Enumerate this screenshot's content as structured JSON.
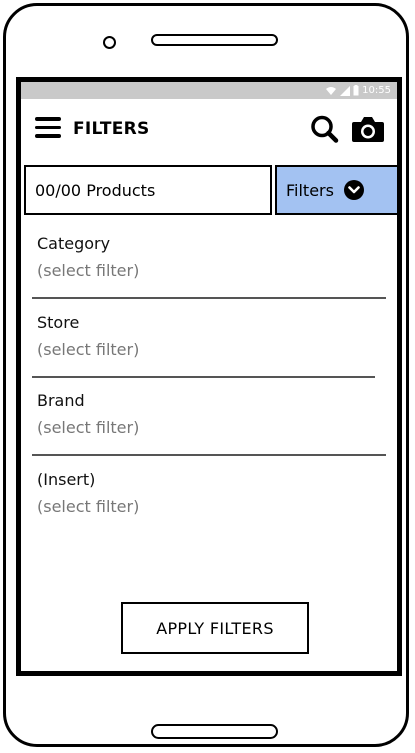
{
  "statusbar": {
    "time": "10:55",
    "icons": [
      "wifi-icon",
      "signal-icon",
      "battery-icon"
    ]
  },
  "appbar": {
    "title": "FILTERS",
    "icons": [
      "menu-icon",
      "search-icon",
      "camera-icon"
    ]
  },
  "toolbar": {
    "products_count": "00/00 Products",
    "filters_label": "Filters",
    "filters_icon": "chevron-down-circle-icon",
    "filters_color": "#a3c2f2"
  },
  "filters": [
    {
      "label": "Category",
      "value": "(select filter)"
    },
    {
      "label": "Store",
      "value": "(select filter)"
    },
    {
      "label": "Brand",
      "value": "(select filter)"
    },
    {
      "label": "(Insert)",
      "value": "(select filter)"
    }
  ],
  "apply_button": {
    "label": "APPLY FILTERS"
  },
  "colors": {
    "statusbar_bg": "#c9c9c9",
    "value_text": "#777777"
  }
}
